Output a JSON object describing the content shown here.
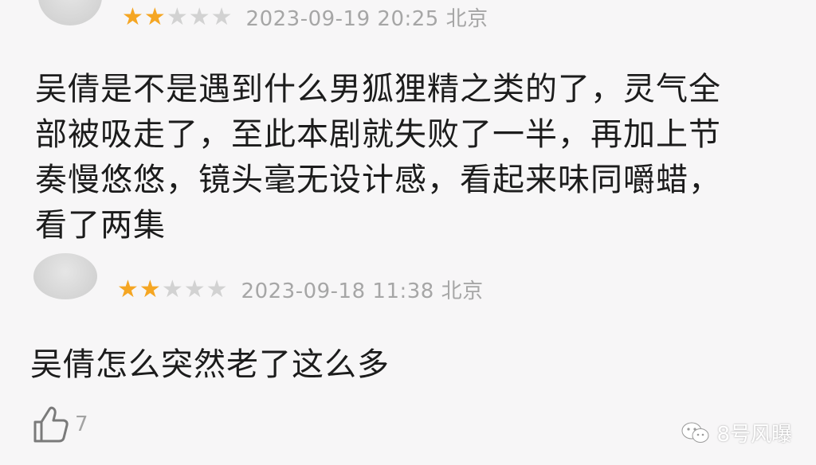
{
  "comments": [
    {
      "rating": 2,
      "stars": [
        "★",
        "★",
        "★",
        "★",
        "★"
      ],
      "date": "2023-09-19 20:25 北京",
      "lines": [
        "吴倩是不是遇到什么男狐狸精之类的了，灵气全",
        "部被吸走了，至此本剧就失败了一半，再加上节",
        "奏慢悠悠，镜头毫无设计感，看起来味同嚼蜡，",
        "看了两集"
      ]
    },
    {
      "rating": 2,
      "stars": [
        "★",
        "★",
        "★",
        "★",
        "★"
      ],
      "date": "2023-09-18 11:38 北京",
      "lines": [
        "吴倩怎么突然老了这么多"
      ],
      "likes": "7"
    }
  ],
  "watermark": "8号风曝",
  "colors": {
    "star_on": "#f5a623",
    "star_off": "#d2d2d2",
    "date": "#a6a6a6",
    "background": "#f7f6f7"
  },
  "icons": {
    "like": "thumbs-up-icon",
    "watermark": "wechat-icon"
  }
}
